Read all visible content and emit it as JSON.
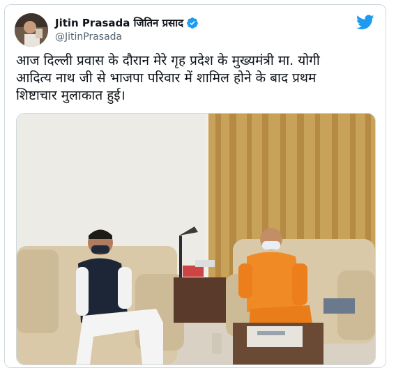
{
  "tweet": {
    "display_name": "Jitin Prasada जितिन प्रसाद",
    "handle": "@JitinPrasada",
    "verified_icon": "verified-badge-icon",
    "brand_icon": "twitter-bird-icon",
    "text": "आज दिल्ली प्रवास के दौरान मेरे गृह प्रदेश के मुख्यमंत्री मा. योगी\nआदित्य नाथ जी से भाजपा परिवार में शामिल होने के बाद प्रथम\nशिष्टाचार मुलाकात हुई।"
  },
  "colors": {
    "brand": "#1d9bf0",
    "text_primary": "#0f1419",
    "text_secondary": "#536471",
    "border": "#cfd9de"
  }
}
